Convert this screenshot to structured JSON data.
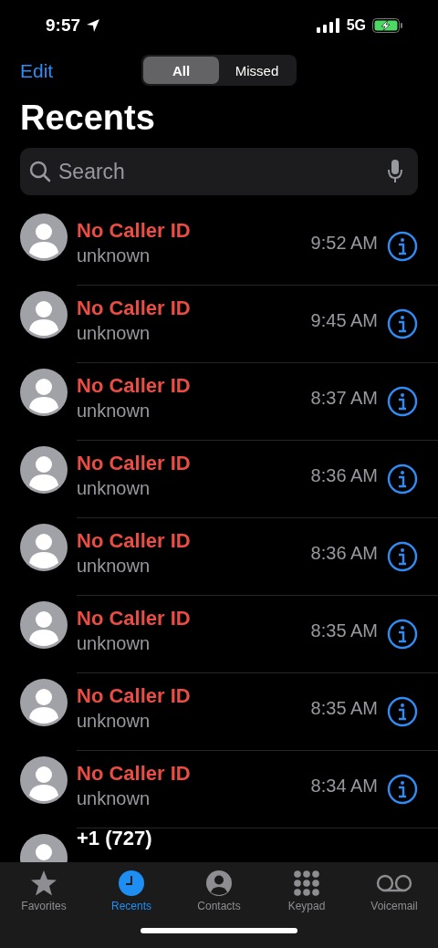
{
  "status_bar": {
    "time": "9:57",
    "network": "5G"
  },
  "nav": {
    "edit": "Edit",
    "segments": [
      {
        "label": "All",
        "selected": true
      },
      {
        "label": "Missed",
        "selected": false
      }
    ]
  },
  "title": "Recents",
  "search": {
    "placeholder": "Search"
  },
  "calls": [
    {
      "name": "No Caller ID",
      "detail": "unknown",
      "time": "9:52 AM",
      "missed": true
    },
    {
      "name": "No Caller ID",
      "detail": "unknown",
      "time": "9:45 AM",
      "missed": true
    },
    {
      "name": "No Caller ID",
      "detail": "unknown",
      "time": "8:37 AM",
      "missed": true
    },
    {
      "name": "No Caller ID",
      "detail": "unknown",
      "time": "8:36 AM",
      "missed": true
    },
    {
      "name": "No Caller ID",
      "detail": "unknown",
      "time": "8:36 AM",
      "missed": true
    },
    {
      "name": "No Caller ID",
      "detail": "unknown",
      "time": "8:35 AM",
      "missed": true
    },
    {
      "name": "No Caller ID",
      "detail": "unknown",
      "time": "8:35 AM",
      "missed": true
    },
    {
      "name": "No Caller ID",
      "detail": "unknown",
      "time": "8:34 AM",
      "missed": true
    },
    {
      "name": "+1 (727)",
      "missed": false
    }
  ],
  "tabs": [
    {
      "kind": "star",
      "label": "Favorites",
      "selected": false
    },
    {
      "kind": "clock",
      "label": "Recents",
      "selected": true
    },
    {
      "kind": "person",
      "label": "Contacts",
      "selected": false
    },
    {
      "kind": "keypad",
      "label": "Keypad",
      "selected": false
    },
    {
      "kind": "voicemail",
      "label": "Voicemail",
      "selected": false
    }
  ]
}
